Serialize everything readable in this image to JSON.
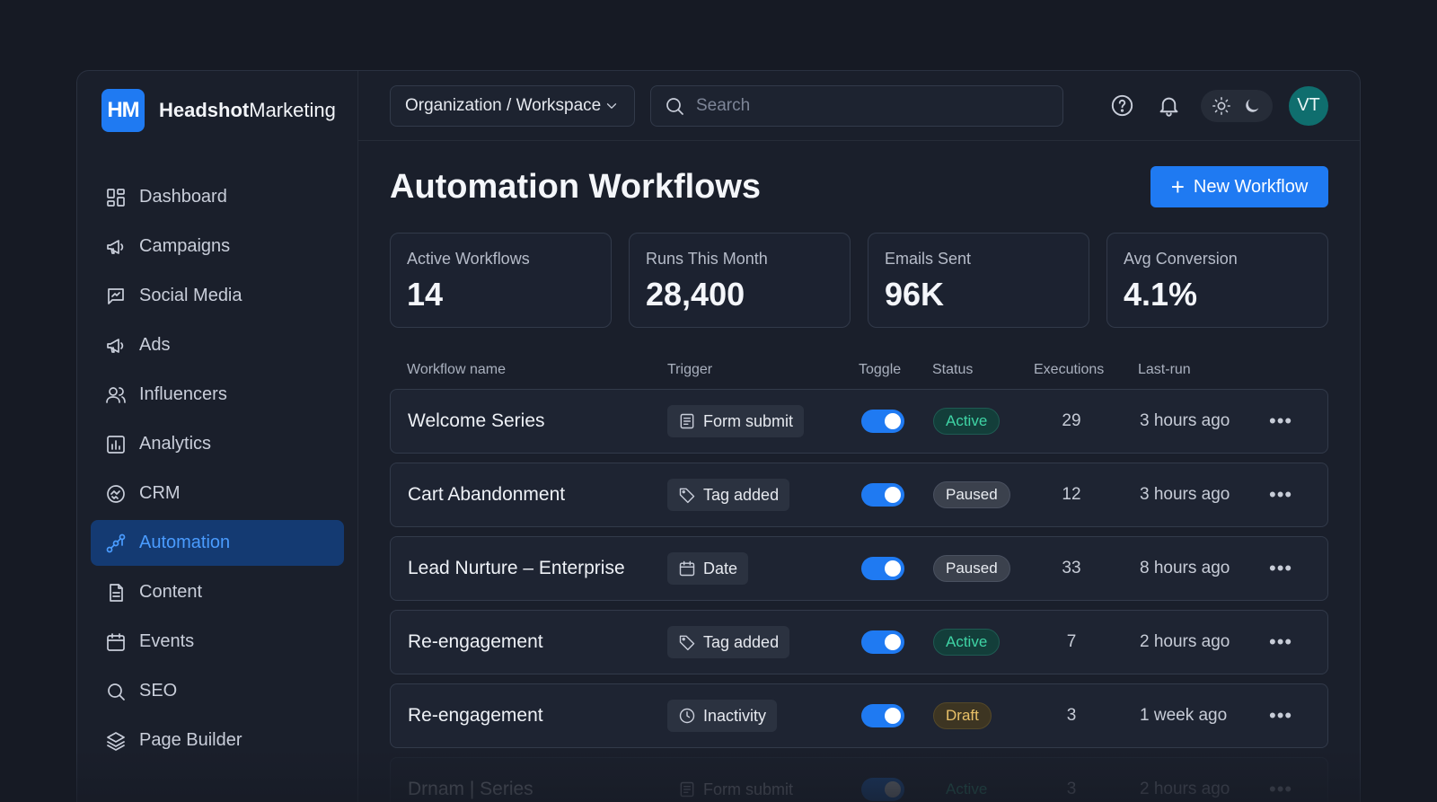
{
  "brand": {
    "logo": "HM",
    "name_bold": "Headshot",
    "name_rest": "Marketing"
  },
  "sidebar": {
    "items": [
      {
        "label": "Dashboard",
        "icon": "grid-icon"
      },
      {
        "label": "Campaigns",
        "icon": "megaphone-icon"
      },
      {
        "label": "Social Media",
        "icon": "chat-icon"
      },
      {
        "label": "Ads",
        "icon": "megaphone-icon"
      },
      {
        "label": "Influencers",
        "icon": "users-icon"
      },
      {
        "label": "Analytics",
        "icon": "bar-chart-icon"
      },
      {
        "label": "CRM",
        "icon": "handshake-icon"
      },
      {
        "label": "Automation",
        "icon": "workflow-icon",
        "active": true
      },
      {
        "label": "Content",
        "icon": "document-icon"
      },
      {
        "label": "Events",
        "icon": "calendar-icon"
      },
      {
        "label": "SEO",
        "icon": "search-icon"
      },
      {
        "label": "Page Builder",
        "icon": "layers-icon"
      }
    ]
  },
  "topbar": {
    "org_label": "Organization / Workspace",
    "search_placeholder": "Search",
    "avatar_initials": "VT"
  },
  "page": {
    "title": "Automation Workflows",
    "new_button_label": "New Workflow"
  },
  "stats": [
    {
      "label": "Active Workflows",
      "value": "14"
    },
    {
      "label": "Runs This Month",
      "value": "28,400"
    },
    {
      "label": "Emails Sent",
      "value": "96K"
    },
    {
      "label": "Avg Conversion",
      "value": "4.1%"
    }
  ],
  "table": {
    "headers": {
      "name": "Workflow name",
      "trigger": "Trigger",
      "toggle": "Toggle",
      "status": "Status",
      "executions": "Executions",
      "last_run": "Last-run"
    },
    "rows": [
      {
        "name": "Welcome Series",
        "trigger": "Form submit",
        "trigger_icon": "form-icon",
        "toggle_on": true,
        "status": "Active",
        "executions": "29",
        "last_run": "3 hours ago"
      },
      {
        "name": "Cart Abandonment",
        "trigger": "Tag added",
        "trigger_icon": "tag-icon",
        "toggle_on": true,
        "status": "Paused",
        "executions": "12",
        "last_run": "3 hours ago"
      },
      {
        "name": "Lead Nurture – Enterprise",
        "trigger": "Date",
        "trigger_icon": "calendar-icon",
        "toggle_on": true,
        "status": "Paused",
        "executions": "33",
        "last_run": "8 hours ago"
      },
      {
        "name": "Re-engagement",
        "trigger": "Tag added",
        "trigger_icon": "tag-icon",
        "toggle_on": true,
        "status": "Active",
        "executions": "7",
        "last_run": "2 hours ago"
      },
      {
        "name": "Re-engagement",
        "trigger": "Inactivity",
        "trigger_icon": "clock-icon",
        "toggle_on": true,
        "status": "Draft",
        "executions": "3",
        "last_run": "1 week ago"
      },
      {
        "name": "Drnam | Series",
        "trigger": "Form submit",
        "trigger_icon": "form-icon",
        "toggle_on": true,
        "status": "Active",
        "executions": "3",
        "last_run": "2 hours ago"
      }
    ]
  },
  "colors": {
    "accent": "#1f7af2",
    "active_status": "#3fd4a5",
    "draft_status": "#e9c168",
    "background": "#161a24"
  }
}
